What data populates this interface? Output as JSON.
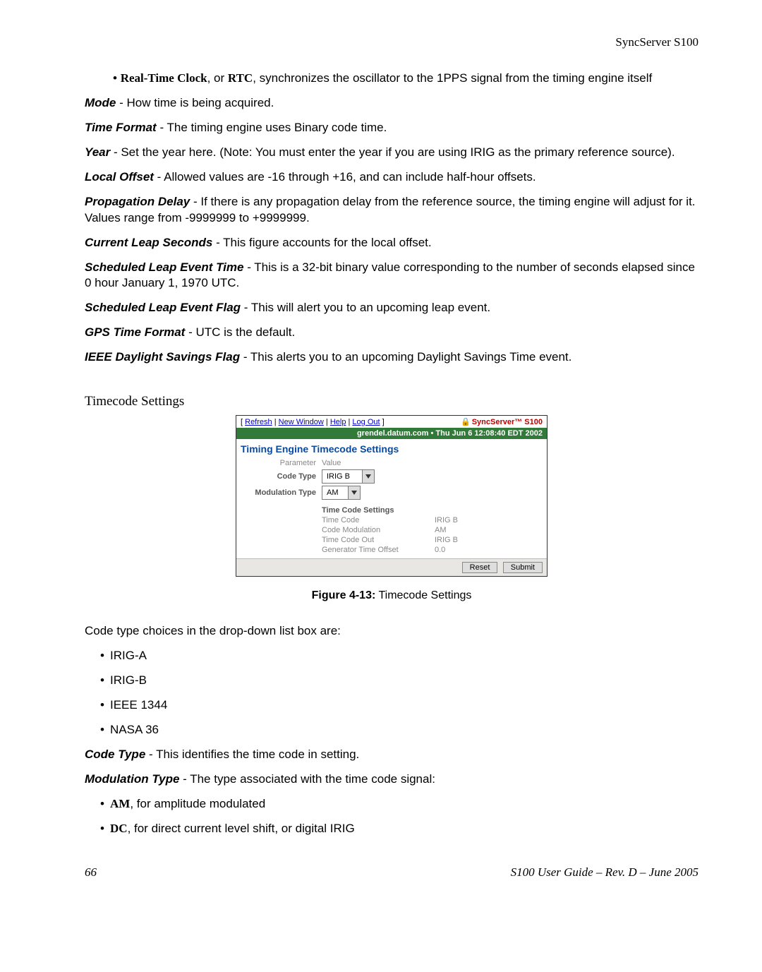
{
  "header": {
    "right": "SyncServer S100"
  },
  "bullets": {
    "rtc_bold": "Real-Time Clock",
    "rtc_or": ", or ",
    "rtc_abbr": "RTC",
    "rtc_rest": ", synchronizes the oscillator to the 1PPS signal from the timing engine itself"
  },
  "defs": {
    "mode_t": "Mode",
    "mode_b": " - How time is being acquired.",
    "tf_t": "Time Format",
    "tf_b": " - The timing engine uses Binary code time.",
    "year_t": "Year",
    "year_b": " - Set the year here. (Note: You must enter the year if you are using IRIG as the primary reference source).",
    "lo_t": "Local Offset",
    "lo_b": " - Allowed values are -16 through +16, and can include half-hour offsets.",
    "pd_t": "Propagation Delay",
    "pd_b": " - If there is any propagation delay from the reference source, the timing engine will adjust for it. Values range from -9999999 to +9999999.",
    "cls_t": "Current Leap Seconds",
    "cls_b": " - This figure accounts for the local offset.",
    "slet_t": "Scheduled Leap Event Time",
    "slet_b": " - This is a 32-bit binary value corresponding to the number of seconds elapsed since 0 hour January 1, 1970 UTC.",
    "slef_t": "Scheduled Leap Event Flag",
    "slef_b": " - This will alert you to an upcoming leap event.",
    "gtf_t": "GPS Time Format",
    "gtf_b": " - UTC is the default.",
    "idsf_t": "IEEE Daylight Savings Flag",
    "idsf_b": " - This alerts you to an upcoming Daylight Savings Time event."
  },
  "section_head": "Timecode Settings",
  "fig": {
    "links": {
      "open": "[ ",
      "refresh": "Refresh",
      "new_window": "New Window",
      "help": "Help",
      "logout": "Log Out",
      "close": " ]",
      "sep": " | "
    },
    "brand": "SyncServer™ S100",
    "greenbar": "grendel.datum.com  •  Thu Jun 6 12:08:40 EDT 2002",
    "title": "Timing Engine Timecode Settings",
    "param_label": "Parameter",
    "value_label": "Value",
    "code_type_label": "Code Type",
    "code_type_value": "IRIG B",
    "mod_type_label": "Modulation Type",
    "mod_type_value": "AM",
    "tc_settings_label": "Time Code Settings",
    "rows": {
      "time_code_l": "Time Code",
      "time_code_v": "IRIG B",
      "code_mod_l": "Code Modulation",
      "code_mod_v": "AM",
      "tco_l": "Time Code Out",
      "tco_v": "IRIG B",
      "gto_l": "Generator Time Offset",
      "gto_v": "0.0"
    },
    "btn_reset": "Reset",
    "btn_submit": "Submit"
  },
  "caption": {
    "bold": "Figure 4-13:",
    "rest": "  Timecode Settings"
  },
  "para2": "Code type choices in the drop-down list box are:",
  "code_types": [
    "IRIG-A",
    "IRIG-B",
    "IEEE 1344",
    "NASA 36"
  ],
  "defs2": {
    "ct_t": "Code Type",
    "ct_b": " - This identifies the time code in setting.",
    "mt_t": "Modulation Type",
    "mt_b": " - The type associated with the time code signal:"
  },
  "mod_bullets": {
    "am_b": "AM",
    "am_r": ", for amplitude modulated",
    "dc_b": "DC",
    "dc_r": ", for direct current level shift, or digital IRIG"
  },
  "footer": {
    "left": "66",
    "right": "S100 User Guide – Rev. D – June 2005"
  }
}
